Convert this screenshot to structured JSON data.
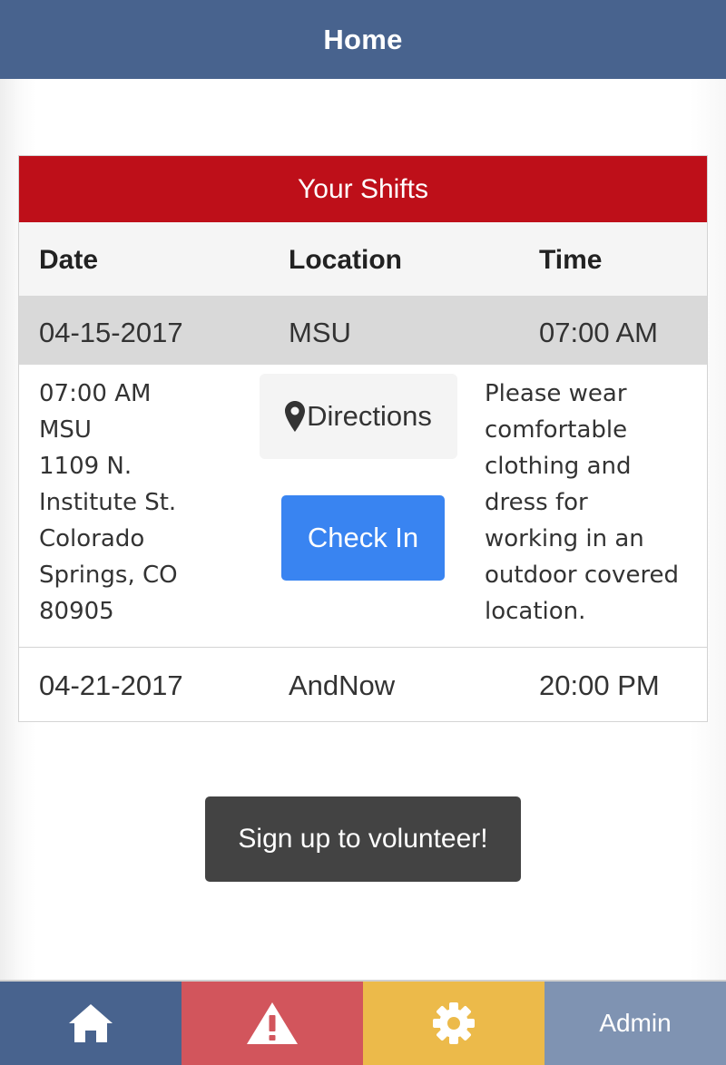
{
  "header": {
    "title": "Home"
  },
  "shifts": {
    "title": "Your Shifts",
    "columns": [
      "Date",
      "Location",
      "Time"
    ],
    "rows": [
      {
        "date": "04-15-2017",
        "location": "MSU",
        "time": "07:00 AM"
      },
      {
        "date": "04-21-2017",
        "location": "AndNow",
        "time": "20:00 PM"
      }
    ],
    "detail": {
      "address_lines": [
        "07:00 AM",
        "MSU",
        "1109 N.",
        "Institute St.",
        "Colorado",
        "Springs, CO",
        "80905"
      ],
      "directions_label": "Directions",
      "checkin_label": "Check In",
      "notes_lines": [
        "Please wear",
        "comfortable",
        "clothing and",
        "dress for",
        "working in an",
        "outdoor covered",
        "location."
      ]
    }
  },
  "signup": {
    "label": "Sign up to volunteer!"
  },
  "tabbar": {
    "tabs": [
      {
        "icon": "home-icon",
        "color": "#48638e"
      },
      {
        "icon": "warning-icon",
        "color": "#d2555c"
      },
      {
        "icon": "gear-icon",
        "color": "#ecba4a"
      },
      {
        "label": "Admin",
        "color": "#7f93b2"
      }
    ]
  },
  "colors": {
    "header": "#48638e",
    "shifts_header": "#be0f19",
    "checkin": "#3984f1",
    "signup": "#434343"
  }
}
